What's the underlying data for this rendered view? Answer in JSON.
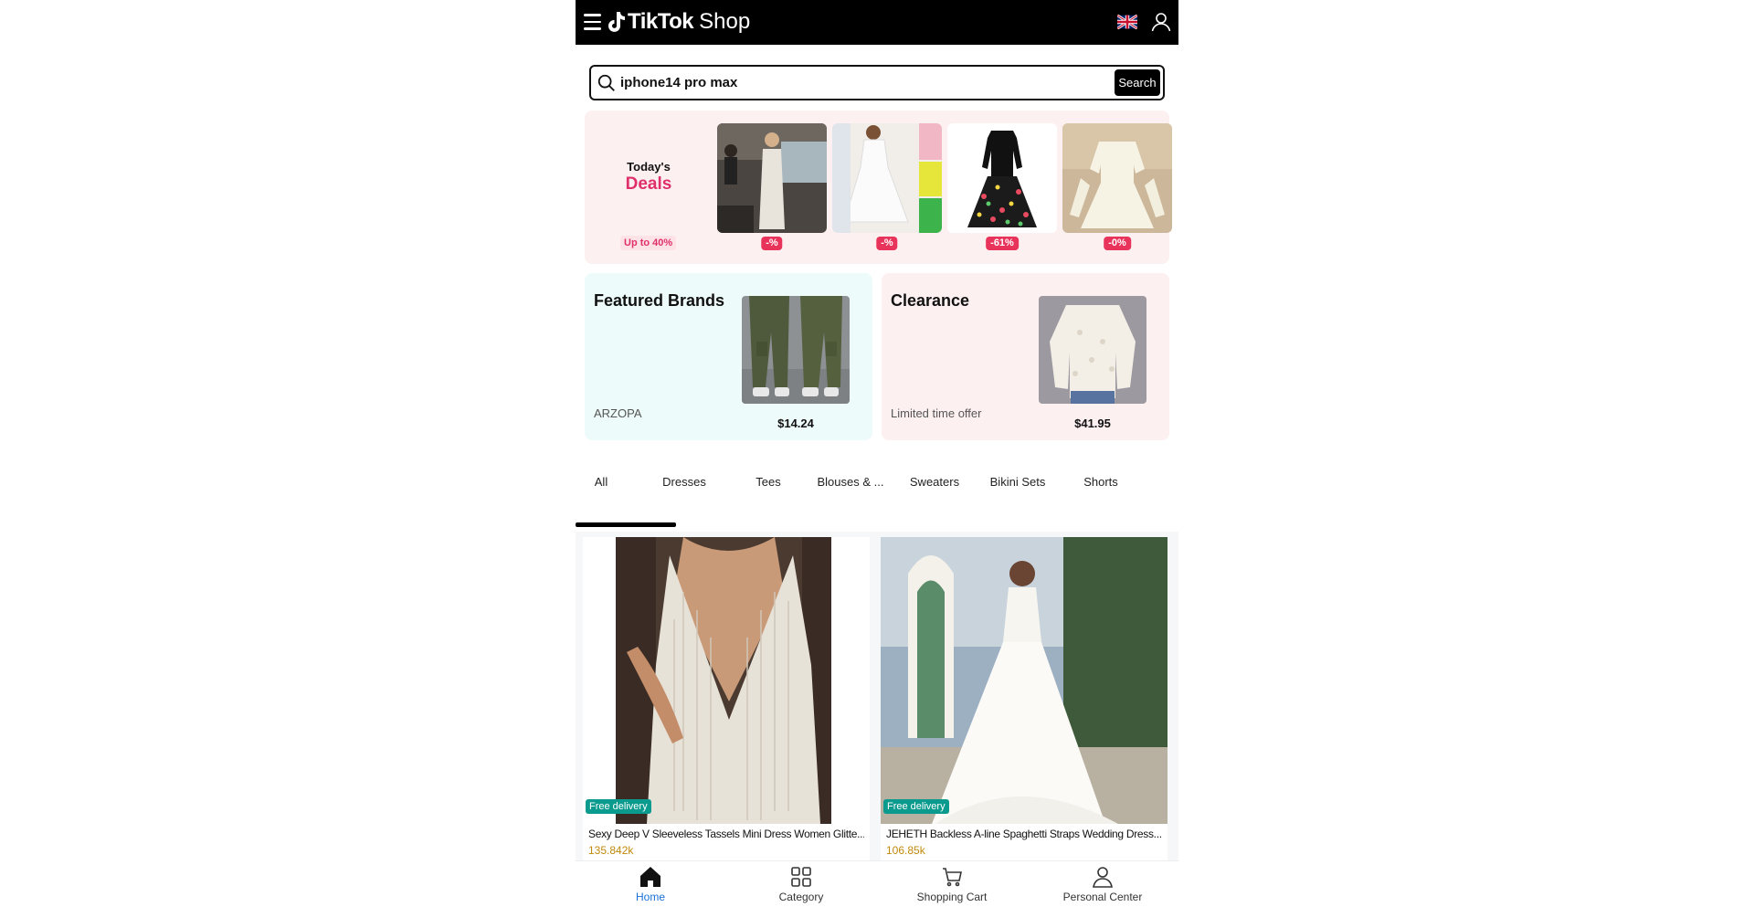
{
  "header": {
    "brand": "TikTok",
    "shop": "Shop"
  },
  "search": {
    "value": "iphone14 pro max",
    "placeholder": "Search",
    "button_label": "Search"
  },
  "deals": {
    "today": "Today's",
    "word": "Deals",
    "up_to": "Up to 40%",
    "items": [
      {
        "badge": "-%"
      },
      {
        "badge": "-%"
      },
      {
        "badge": "-61%"
      },
      {
        "badge": "-0%"
      }
    ]
  },
  "promos": {
    "featured": {
      "title": "Featured Brands",
      "subtitle": "ARZOPA",
      "price": "$14.24"
    },
    "clearance": {
      "title": "Clearance",
      "subtitle": "Limited time offer",
      "price": "$41.95"
    }
  },
  "tabs": [
    "All",
    "Dresses",
    "Tees",
    "Blouses & ...",
    "Sweaters",
    "Bikini Sets",
    "Shorts"
  ],
  "products": [
    {
      "badge": "Free delivery",
      "title": "Sexy Deep V Sleeveless Tassels Mini Dress Women Glitte...",
      "sold": "135.842k"
    },
    {
      "badge": "Free delivery",
      "title": "JEHETH Backless A-line Spaghetti Straps Wedding Dress...",
      "sold": "106.85k"
    }
  ],
  "bottom_nav": {
    "home": "Home",
    "category": "Category",
    "cart": "Shopping Cart",
    "personal": "Personal Center"
  },
  "colors": {
    "accent_pink": "#e0306b",
    "badge_teal": "#0b9b8e",
    "nav_active": "#1a6fd6",
    "sold_gold": "#c08a0b"
  }
}
